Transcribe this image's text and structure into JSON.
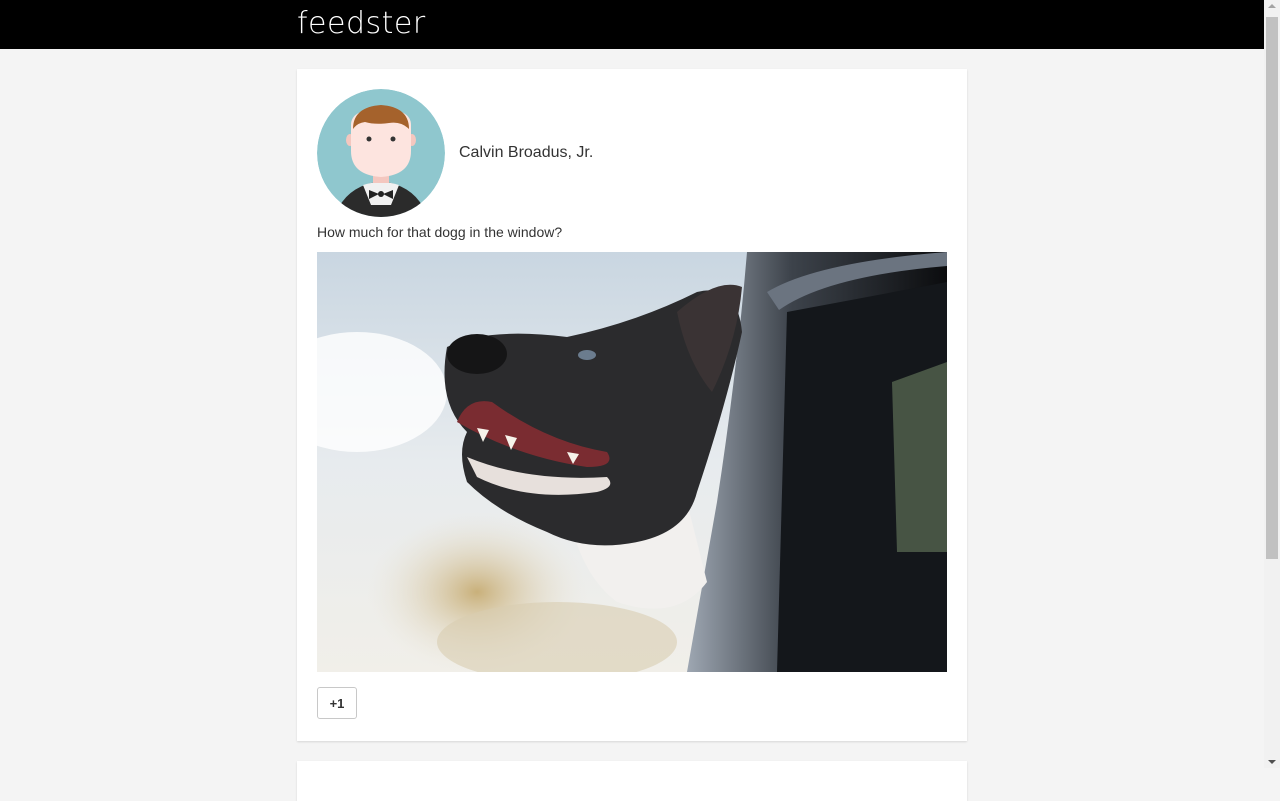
{
  "app": {
    "brand": "feedster"
  },
  "post": {
    "author_name": "Calvin Broadus, Jr.",
    "text": "How much for that dogg in the window?",
    "plus_one_label": "+1"
  },
  "colors": {
    "header_bg": "#000000",
    "page_bg": "#f4f4f4",
    "avatar_bg": "#8fc7ce"
  }
}
